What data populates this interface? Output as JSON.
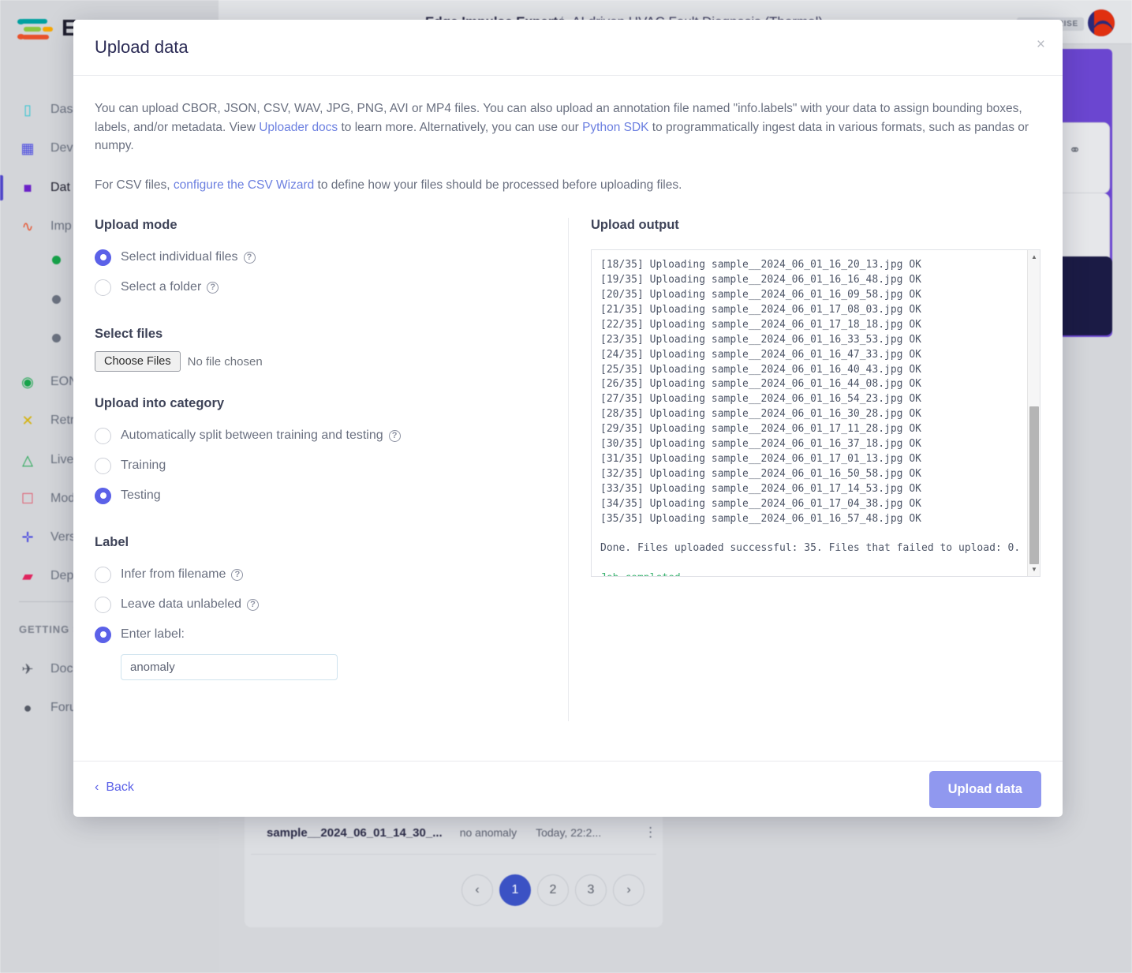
{
  "background": {
    "logo_text": "E",
    "topbar": {
      "project_org": "Edge Impulse Experts",
      "separator": "/",
      "project_name": "AI driven HVAC Fault Diagnosis (Thermal)",
      "enterprise_badge": "ENTERPRISE"
    },
    "sidebar": {
      "items": [
        {
          "label": "Das",
          "icon": "dashboard-icon",
          "active": false
        },
        {
          "label": "Dev",
          "icon": "devices-chip-icon",
          "active": false
        },
        {
          "label": "Dat",
          "icon": "database-icon",
          "active": true
        },
        {
          "label": "Imp",
          "icon": "impulse-wave-icon",
          "active": false
        },
        {
          "label": "EON",
          "icon": "compass-icon",
          "active": false
        },
        {
          "label": "Retr",
          "icon": "retrain-shuffle-icon",
          "active": false
        },
        {
          "label": "Live",
          "icon": "live-classification-icon",
          "active": false
        },
        {
          "label": "Mod",
          "icon": "model-testing-clipboard-icon",
          "active": false
        },
        {
          "label": "Vers",
          "icon": "versioning-branch-icon",
          "active": false
        },
        {
          "label": "Dep",
          "icon": "deployment-box-icon",
          "active": false
        }
      ],
      "section_title": "GETTING S",
      "footer_items": [
        {
          "label": "Doc",
          "icon": "rocket-icon"
        },
        {
          "label": "Foru",
          "icon": "forum-chat-icon"
        }
      ]
    },
    "data_panel": {
      "sample_name": "sample__2024_06_01_14_30_...",
      "sample_label": "no anomaly",
      "sample_time": "Today, 22:2...",
      "row_menu": "⋮",
      "pagination": {
        "prev": "‹",
        "next": "›",
        "pages": [
          "1",
          "2",
          "3"
        ],
        "current": "1"
      }
    }
  },
  "modal": {
    "title": "Upload data",
    "close_label": "×",
    "intro": {
      "p1_a": "You can upload CBOR, JSON, CSV, WAV, JPG, PNG, AVI or MP4 files. You can also upload an annotation file named \"info.labels\" with your data to assign bounding boxes, labels, and/or metadata. View ",
      "p1_link1": "Uploader docs",
      "p1_b": " to learn more. Alternatively, you can use our ",
      "p1_link2": "Python SDK",
      "p1_c": " to programmatically ingest data in various formats, such as pandas or numpy.",
      "p2_a": "For CSV files, ",
      "p2_link": "configure the CSV Wizard",
      "p2_b": " to define how your files should be processed before uploading files."
    },
    "upload_mode": {
      "heading": "Upload mode",
      "options": [
        {
          "label": "Select individual files",
          "selected": true,
          "help": "?"
        },
        {
          "label": "Select a folder",
          "selected": false,
          "help": "?"
        }
      ]
    },
    "select_files": {
      "heading": "Select files",
      "choose_button": "Choose Files",
      "no_file_text": "No file chosen"
    },
    "upload_category": {
      "heading": "Upload into category",
      "options": [
        {
          "label": "Automatically split between training and testing",
          "selected": false,
          "help": "?"
        },
        {
          "label": "Training",
          "selected": false,
          "help": ""
        },
        {
          "label": "Testing",
          "selected": true,
          "help": ""
        }
      ]
    },
    "label_section": {
      "heading": "Label",
      "options": [
        {
          "label": "Infer from filename",
          "selected": false,
          "help": "?"
        },
        {
          "label": "Leave data unlabeled",
          "selected": false,
          "help": "?"
        },
        {
          "label": "Enter label:",
          "selected": true,
          "help": ""
        }
      ],
      "input_value": "anomaly",
      "input_placeholder": ""
    },
    "upload_output": {
      "heading": "Upload output",
      "lines": [
        "[18/35] Uploading sample__2024_06_01_16_20_13.jpg OK",
        "[19/35] Uploading sample__2024_06_01_16_16_48.jpg OK",
        "[20/35] Uploading sample__2024_06_01_16_09_58.jpg OK",
        "[21/35] Uploading sample__2024_06_01_17_08_03.jpg OK",
        "[22/35] Uploading sample__2024_06_01_17_18_18.jpg OK",
        "[23/35] Uploading sample__2024_06_01_16_33_53.jpg OK",
        "[24/35] Uploading sample__2024_06_01_16_47_33.jpg OK",
        "[25/35] Uploading sample__2024_06_01_16_40_43.jpg OK",
        "[26/35] Uploading sample__2024_06_01_16_44_08.jpg OK",
        "[27/35] Uploading sample__2024_06_01_16_54_23.jpg OK",
        "[28/35] Uploading sample__2024_06_01_16_30_28.jpg OK",
        "[29/35] Uploading sample__2024_06_01_17_11_28.jpg OK",
        "[30/35] Uploading sample__2024_06_01_16_37_18.jpg OK",
        "[31/35] Uploading sample__2024_06_01_17_01_13.jpg OK",
        "[32/35] Uploading sample__2024_06_01_16_50_58.jpg OK",
        "[33/35] Uploading sample__2024_06_01_17_14_53.jpg OK",
        "[34/35] Uploading sample__2024_06_01_17_04_38.jpg OK",
        "[35/35] Uploading sample__2024_06_01_16_57_48.jpg OK"
      ],
      "summary": "Done. Files uploaded successful: 35. Files that failed to upload: 0.",
      "job_status": "Job completed",
      "scrollbar": {
        "up_arrow": "▲",
        "down_arrow": "▼"
      }
    },
    "footer": {
      "back_label": "Back",
      "back_chevron": "‹",
      "upload_label": "Upload data"
    }
  },
  "colors": {
    "accent_purple": "#5b61e8",
    "button_purple": "#9098ef",
    "link_blue": "#6b7fe0",
    "success_green": "#3cb371",
    "pager_active": "#3b52c4",
    "panel_purple": "#6b46d0",
    "dark_navy": "#1b1b45"
  }
}
